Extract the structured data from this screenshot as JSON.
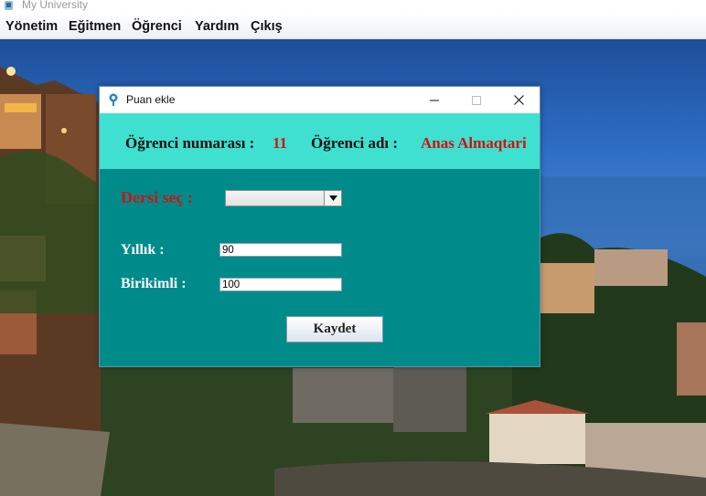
{
  "app": {
    "title": "My University"
  },
  "menu": [
    "Yönetim",
    "Eğitmen",
    "Öğrenci",
    "Yardım",
    "Çıkış"
  ],
  "dialog": {
    "title": "Puan ekle",
    "student_number_label": "Öğrenci numarası :",
    "student_number": "11",
    "student_name_label": "Öğrenci adı  :",
    "student_name": "Anas Almaqtari",
    "course_label": "Dersi seç :",
    "course_selected": "",
    "yillik_label": "Yıllık  :",
    "yillik_value": "90",
    "birikimli_label": "Birikimli :",
    "birikimli_value": "100",
    "save_button": "Kaydet"
  },
  "colors": {
    "dialog_bg": "#008b8b",
    "info_band": "#40e0d0",
    "accent_red": "#d01212"
  }
}
